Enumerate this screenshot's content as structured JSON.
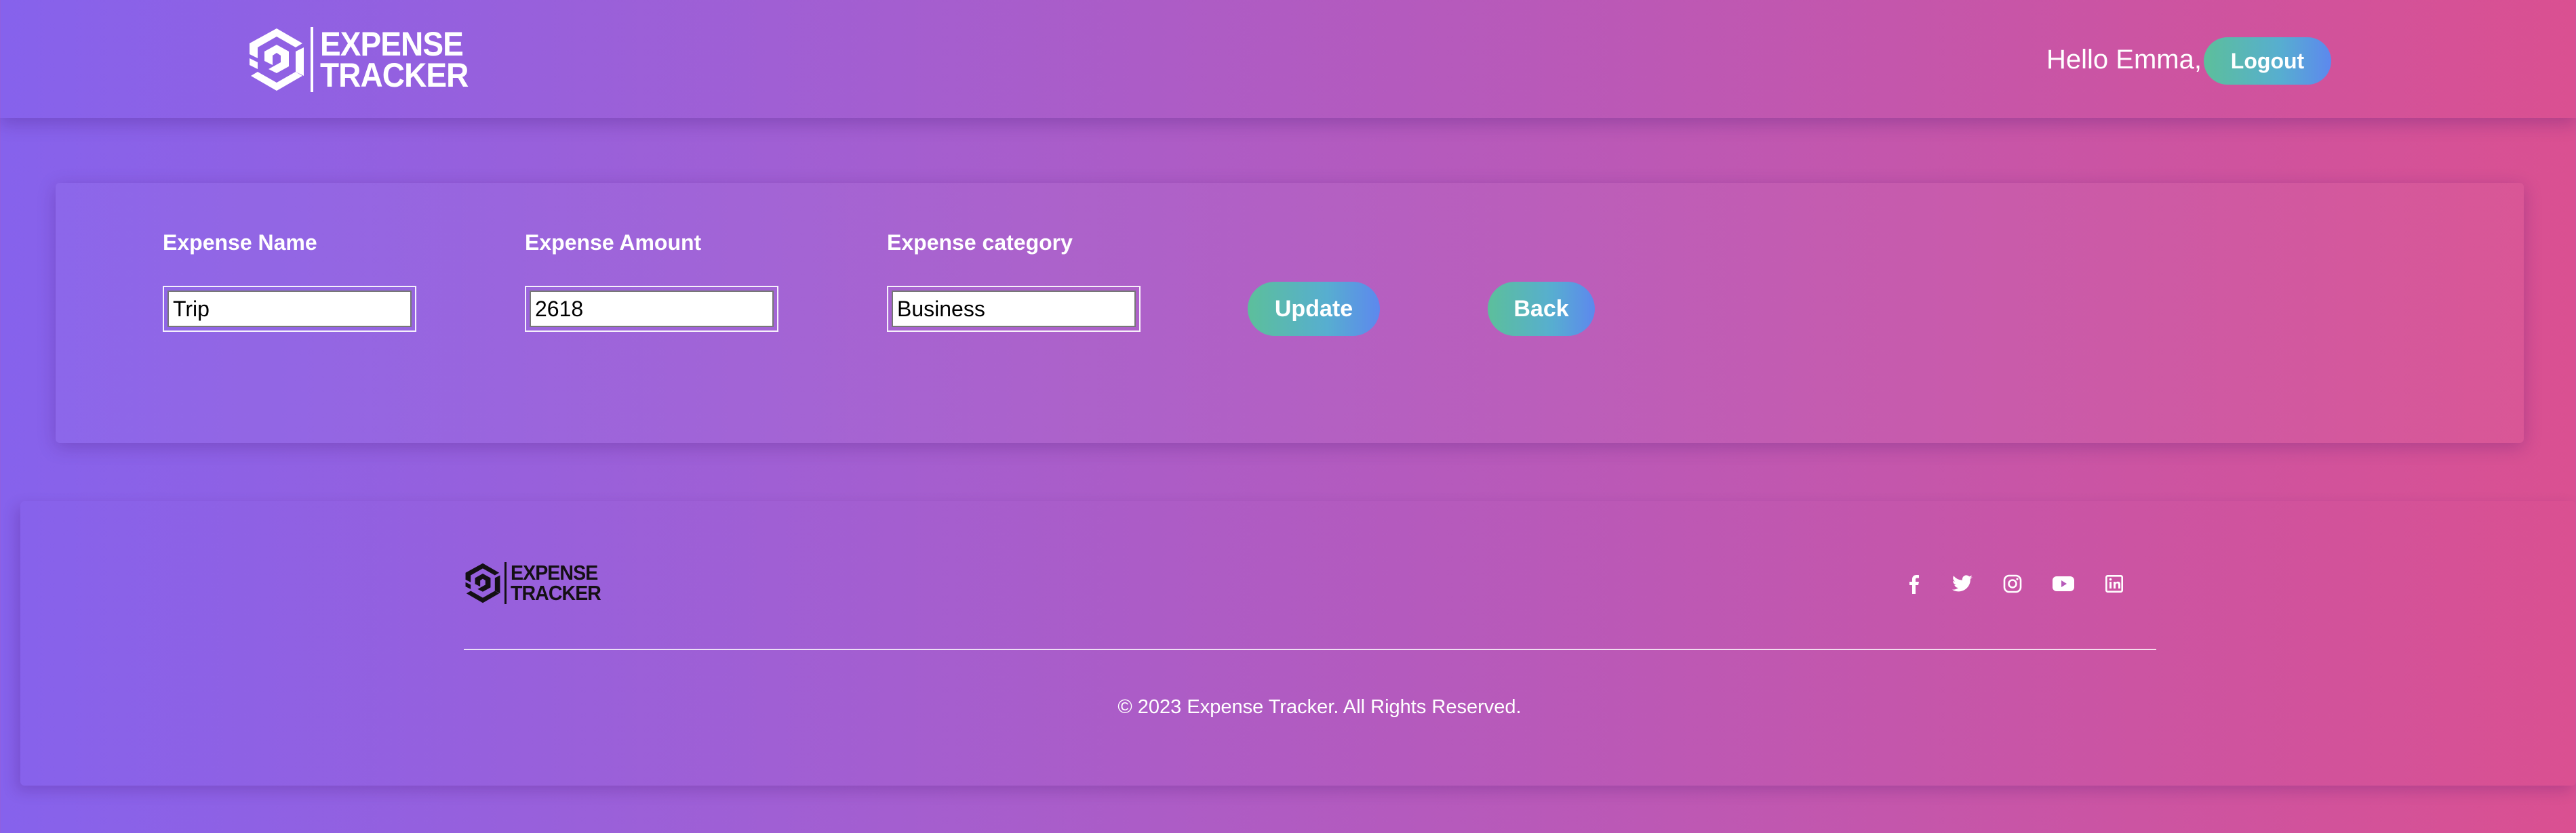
{
  "header": {
    "logo_line1": "EXPENSE",
    "logo_line2": "TRACKER",
    "greeting": "Hello Emma,",
    "logout_label": "Logout"
  },
  "form": {
    "name_label": "Expense Name",
    "name_value": "Trip",
    "amount_label": "Expense Amount",
    "amount_value": "2618",
    "category_label": "Expense category",
    "category_value": "Business",
    "update_label": "Update",
    "back_label": "Back"
  },
  "footer": {
    "logo_line1": "EXPENSE",
    "logo_line2": "TRACKER",
    "social_icons": [
      "facebook-icon",
      "twitter-icon",
      "instagram-icon",
      "youtube-icon",
      "linkedin-icon"
    ],
    "copyright": "© 2023 Expense Tracker. All Rights Reserved."
  },
  "colors": {
    "bg_gradient_start": "#8662ec",
    "bg_gradient_end": "#da5091",
    "button_gradient_start": "#5cbf9b",
    "button_gradient_end": "#5d88ee"
  }
}
